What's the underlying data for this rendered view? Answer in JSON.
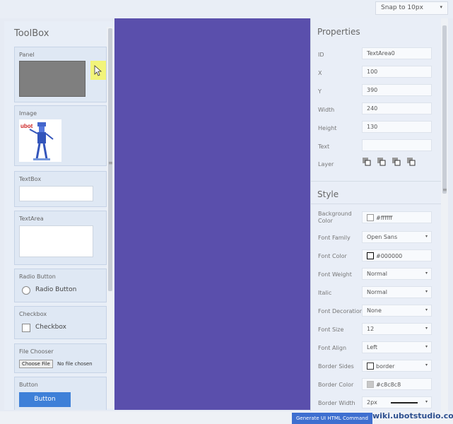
{
  "topbar": {
    "snap_label": "Snap to 10px"
  },
  "toolbox": {
    "title": "ToolBox",
    "panel_label": "Panel",
    "image_label": "Image",
    "image_logo_text": "ubot",
    "textbox_label": "TextBox",
    "textarea_label": "TextArea",
    "radio_label": "Radio Button",
    "radio_text": "Radio Button",
    "checkbox_label": "Checkbox",
    "checkbox_text": "Checkbox",
    "file_label": "File Chooser",
    "file_button": "Choose File",
    "file_status": "No file chosen",
    "button_label": "Button",
    "button_text": "Button"
  },
  "properties": {
    "title": "Properties",
    "rows": [
      {
        "label": "ID",
        "value": "TextArea0"
      },
      {
        "label": "X",
        "value": "100"
      },
      {
        "label": "Y",
        "value": "390"
      },
      {
        "label": "Width",
        "value": "240"
      },
      {
        "label": "Height",
        "value": "130"
      },
      {
        "label": "Text",
        "value": ""
      }
    ],
    "layer_label": "Layer"
  },
  "style": {
    "title": "Style",
    "bg_label": "Background Color",
    "bg_value": "#ffffff",
    "font_family_label": "Font Family",
    "font_family_value": "Open Sans",
    "font_color_label": "Font Color",
    "font_color_value": "#000000",
    "font_weight_label": "Font Weight",
    "font_weight_value": "Normal",
    "italic_label": "Italic",
    "italic_value": "Normal",
    "font_decoration_label": "Font Decoration",
    "font_decoration_value": "None",
    "font_size_label": "Font Size",
    "font_size_value": "12",
    "font_align_label": "Font Align",
    "font_align_value": "Left",
    "border_sides_label": "Border Sides",
    "border_sides_value": "border",
    "border_color_label": "Border Color",
    "border_color_value": "#c8c8c8",
    "border_width_label": "Border Width",
    "border_width_value": "2px"
  },
  "footer": {
    "generate_label": "Generate UI HTML Command",
    "watermark": "wiki.ubotstudio.com"
  },
  "colors": {
    "canvas": "#5a4fac",
    "accent": "#3e6fd0"
  }
}
